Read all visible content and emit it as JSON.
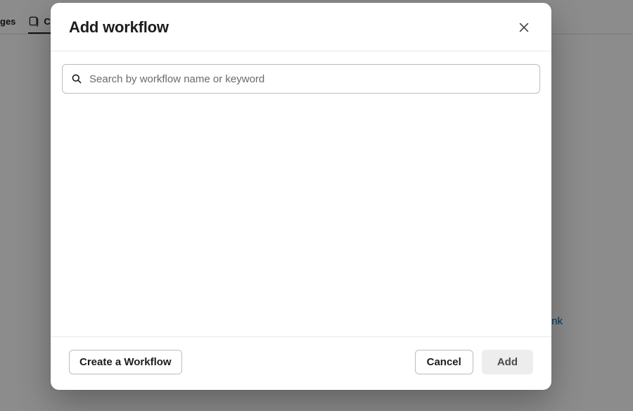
{
  "background": {
    "tab1_label": "ges",
    "tab2_label": "C",
    "link_text": "e_link"
  },
  "modal": {
    "title": "Add workflow",
    "search": {
      "placeholder": "Search by workflow name or keyword",
      "value": ""
    },
    "footer": {
      "create_label": "Create a Workflow",
      "cancel_label": "Cancel",
      "add_label": "Add"
    }
  }
}
